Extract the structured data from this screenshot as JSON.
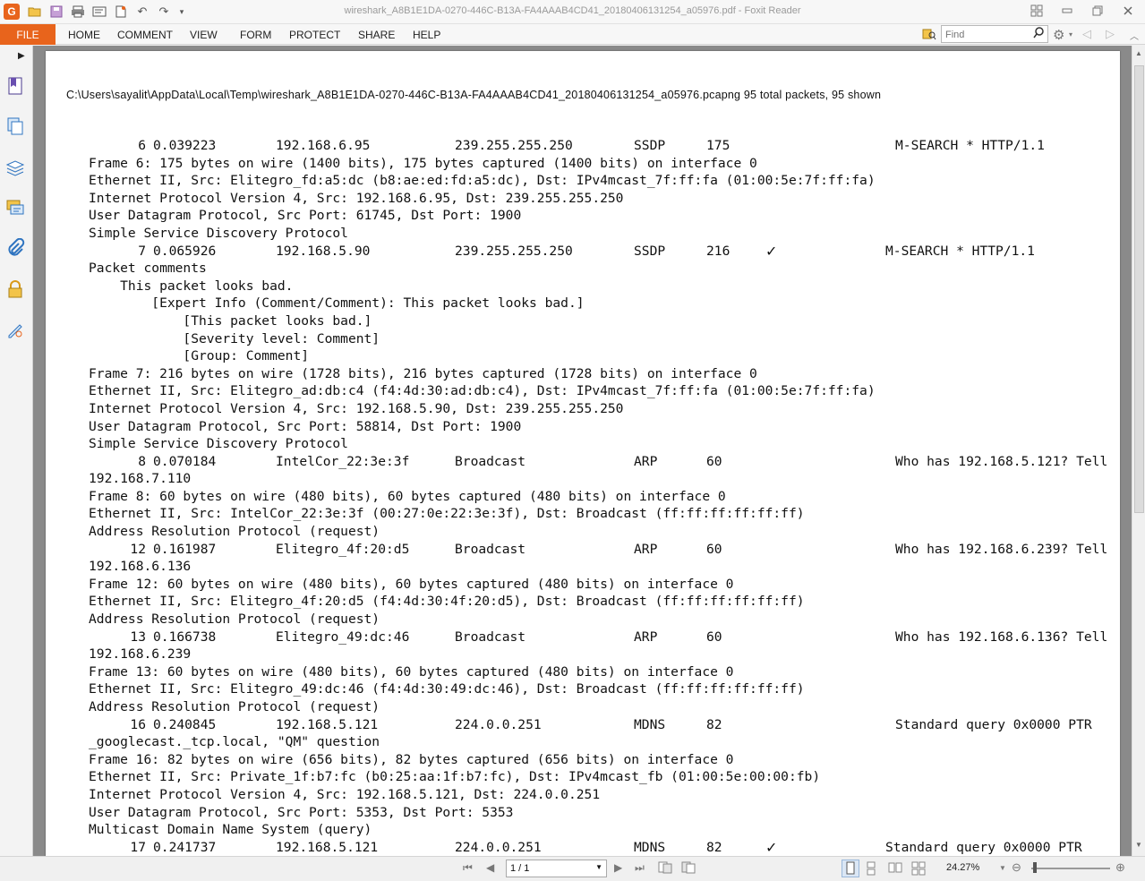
{
  "window": {
    "title": "wireshark_A8B1E1DA-0270-446C-B13A-FA4AAAB4CD41_20180406131254_a05976.pdf - Foxit Reader"
  },
  "ribbon": {
    "file_label": "FILE",
    "tabs": [
      "HOME",
      "COMMENT",
      "VIEW",
      "FORM",
      "PROTECT",
      "SHARE",
      "HELP"
    ],
    "search_placeholder": "Find"
  },
  "document": {
    "header_line": "C:\\Users\\sayalit\\AppData\\Local\\Temp\\wireshark_A8B1E1DA-0270-446C-B13A-FA4AAAB4CD41_20180406131254_a05976.pcapng 95 total packets, 95 shown",
    "packets": [
      {
        "no": "6",
        "time": "0.039223",
        "src": "192.168.6.95",
        "dst": "239.255.255.250",
        "proto": "SSDP",
        "len": "175",
        "flag": "",
        "info": "M-SEARCH * HTTP/1.1",
        "info_wrap": "",
        "details": [
          "Frame 6: 175 bytes on wire (1400 bits), 175 bytes captured (1400 bits) on interface 0",
          "Ethernet II, Src: Elitegro_fd:a5:dc (b8:ae:ed:fd:a5:dc), Dst: IPv4mcast_7f:ff:fa (01:00:5e:7f:ff:fa)",
          "Internet Protocol Version 4, Src: 192.168.6.95, Dst: 239.255.255.250",
          "User Datagram Protocol, Src Port: 61745, Dst Port: 1900",
          "Simple Service Discovery Protocol"
        ]
      },
      {
        "no": "7",
        "time": "0.065926",
        "src": "192.168.5.90",
        "dst": "239.255.255.250",
        "proto": "SSDP",
        "len": "216",
        "flag": "✓",
        "info": "M-SEARCH * HTTP/1.1",
        "info_wrap": "",
        "details": [
          "Packet comments",
          "    This packet looks bad.",
          "        [Expert Info (Comment/Comment): This packet looks bad.]",
          "            [This packet looks bad.]",
          "            [Severity level: Comment]",
          "            [Group: Comment]",
          "Frame 7: 216 bytes on wire (1728 bits), 216 bytes captured (1728 bits) on interface 0",
          "Ethernet II, Src: Elitegro_ad:db:c4 (f4:4d:30:ad:db:c4), Dst: IPv4mcast_7f:ff:fa (01:00:5e:7f:ff:fa)",
          "Internet Protocol Version 4, Src: 192.168.5.90, Dst: 239.255.255.250",
          "User Datagram Protocol, Src Port: 58814, Dst Port: 1900",
          "Simple Service Discovery Protocol"
        ]
      },
      {
        "no": "8",
        "time": "0.070184",
        "src": "IntelCor_22:3e:3f",
        "dst": "Broadcast",
        "proto": "ARP",
        "len": "60",
        "flag": "",
        "info": "Who has 192.168.5.121? Tell",
        "info_wrap": "192.168.7.110",
        "details": [
          "Frame 8: 60 bytes on wire (480 bits), 60 bytes captured (480 bits) on interface 0",
          "Ethernet II, Src: IntelCor_22:3e:3f (00:27:0e:22:3e:3f), Dst: Broadcast (ff:ff:ff:ff:ff:ff)",
          "Address Resolution Protocol (request)"
        ]
      },
      {
        "no": "12",
        "time": "0.161987",
        "src": "Elitegro_4f:20:d5",
        "dst": "Broadcast",
        "proto": "ARP",
        "len": "60",
        "flag": "",
        "info": "Who has 192.168.6.239? Tell",
        "info_wrap": "192.168.6.136",
        "details": [
          "Frame 12: 60 bytes on wire (480 bits), 60 bytes captured (480 bits) on interface 0",
          "Ethernet II, Src: Elitegro_4f:20:d5 (f4:4d:30:4f:20:d5), Dst: Broadcast (ff:ff:ff:ff:ff:ff)",
          "Address Resolution Protocol (request)"
        ]
      },
      {
        "no": "13",
        "time": "0.166738",
        "src": "Elitegro_49:dc:46",
        "dst": "Broadcast",
        "proto": "ARP",
        "len": "60",
        "flag": "",
        "info": "Who has 192.168.6.136? Tell",
        "info_wrap": "192.168.6.239",
        "details": [
          "Frame 13: 60 bytes on wire (480 bits), 60 bytes captured (480 bits) on interface 0",
          "Ethernet II, Src: Elitegro_49:dc:46 (f4:4d:30:49:dc:46), Dst: Broadcast (ff:ff:ff:ff:ff:ff)",
          "Address Resolution Protocol (request)"
        ]
      },
      {
        "no": "16",
        "time": "0.240845",
        "src": "192.168.5.121",
        "dst": "224.0.0.251",
        "proto": "MDNS",
        "len": "82",
        "flag": "",
        "info": "Standard query 0x0000 PTR",
        "info_wrap": "_googlecast._tcp.local, \"QM\" question",
        "details": [
          "Frame 16: 82 bytes on wire (656 bits), 82 bytes captured (656 bits) on interface 0",
          "Ethernet II, Src: Private_1f:b7:fc (b0:25:aa:1f:b7:fc), Dst: IPv4mcast_fb (01:00:5e:00:00:fb)",
          "Internet Protocol Version 4, Src: 192.168.5.121, Dst: 224.0.0.251",
          "User Datagram Protocol, Src Port: 5353, Dst Port: 5353",
          "Multicast Domain Name System (query)"
        ]
      },
      {
        "no": "17",
        "time": "0.241737",
        "src": "192.168.5.121",
        "dst": "224.0.0.251",
        "proto": "MDNS",
        "len": "82",
        "flag": "✓",
        "info": "Standard query 0x0000 PTR",
        "info_wrap": "",
        "details": []
      }
    ]
  },
  "statusbar": {
    "page_indicator": "1 / 1",
    "zoom": "24.27%"
  },
  "colors": {
    "accent": "#e8641c",
    "sidebar_icon": "#2f74c0"
  }
}
